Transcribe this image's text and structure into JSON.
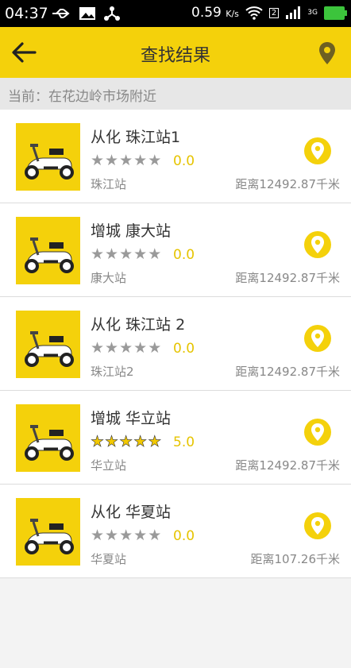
{
  "status": {
    "time": "04:37",
    "speed": "0.59",
    "speed_unit": "K/s",
    "sim": "2",
    "network": "3G"
  },
  "header": {
    "title": "查找结果",
    "back_icon": "arrow-left-icon",
    "location_icon": "map-pin-icon"
  },
  "subheader": {
    "text": "当前：在花边岭市场附近"
  },
  "colors": {
    "brand": "#f4d10b",
    "rating": "#e6c400"
  },
  "stations": [
    {
      "name": "从化 珠江站1",
      "rating": "0.0",
      "rating_value": 0,
      "address": "珠江站",
      "distance": "距离12492.87千米"
    },
    {
      "name": "增城 康大站",
      "rating": "0.0",
      "rating_value": 0,
      "address": "康大站",
      "distance": "距离12492.87千米"
    },
    {
      "name": "从化 珠江站 2",
      "rating": "0.0",
      "rating_value": 0,
      "address": "珠江站2",
      "distance": "距离12492.87千米"
    },
    {
      "name": "增城 华立站",
      "rating": "5.0",
      "rating_value": 5,
      "address": "华立站",
      "distance": "距离12492.87千米"
    },
    {
      "name": "从化 华夏站",
      "rating": "0.0",
      "rating_value": 0,
      "address": "华夏站",
      "distance": "距离107.26千米"
    }
  ]
}
